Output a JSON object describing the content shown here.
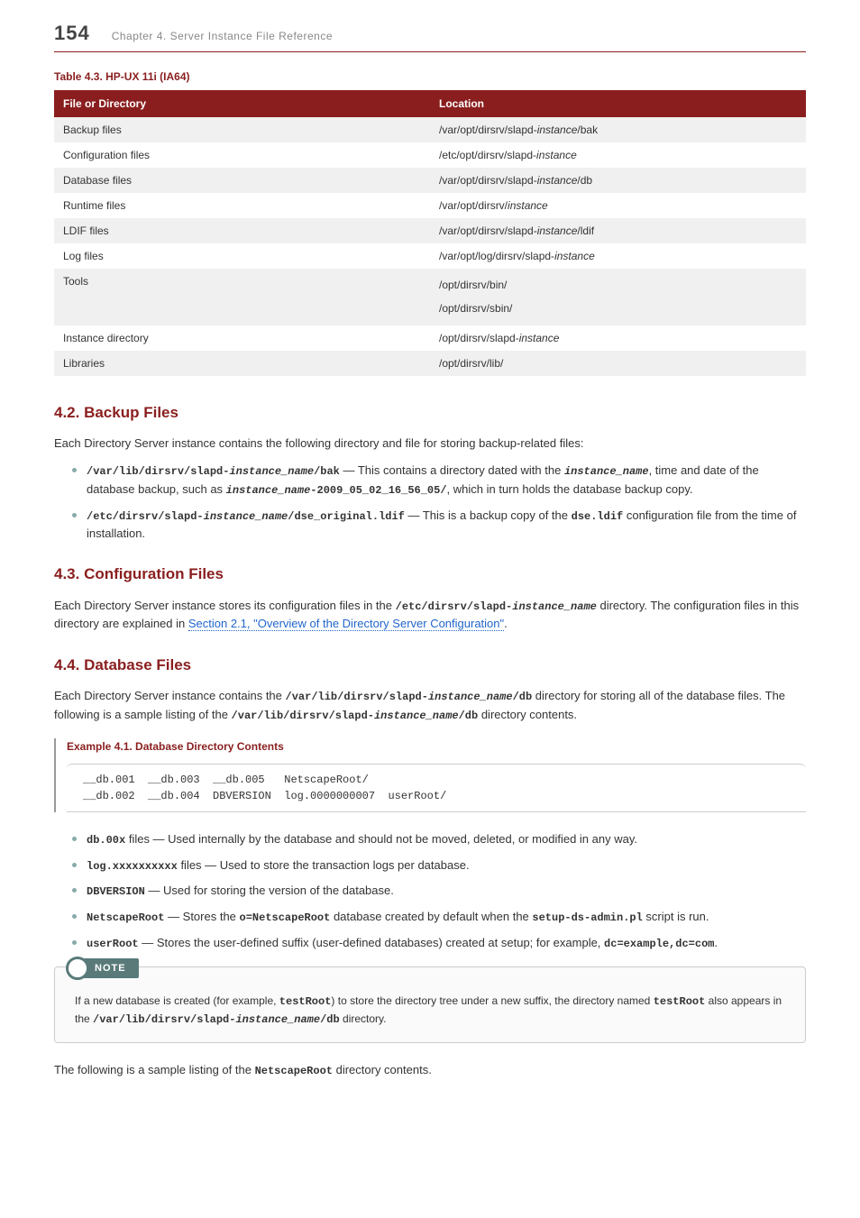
{
  "header": {
    "page_number": "154",
    "chapter": "Chapter 4. Server Instance File Reference"
  },
  "table": {
    "caption": "Table 4.3. HP-UX 11i (IA64)",
    "col1": "File or Directory",
    "col2": "Location",
    "rows": [
      {
        "name": "Backup files",
        "pre": "/var/opt/dirsrv/slapd-",
        "it": "instance",
        "post": "/bak"
      },
      {
        "name": "Configuration files",
        "pre": "/etc/opt/dirsrv/slapd-",
        "it": "instance",
        "post": ""
      },
      {
        "name": "Database files",
        "pre": "/var/opt/dirsrv/slapd-",
        "it": "instance",
        "post": "/db"
      },
      {
        "name": "Runtime files",
        "pre": "/var/opt/dirsrv/",
        "it": "instance",
        "post": ""
      },
      {
        "name": "LDIF files",
        "pre": "/var/opt/dirsrv/slapd-",
        "it": "instance",
        "post": "/ldif"
      },
      {
        "name": "Log files",
        "pre": "/var/opt/log/dirsrv/slapd-",
        "it": "instance",
        "post": ""
      }
    ],
    "tools_name": "Tools",
    "tools_loc1": "/opt/dirsrv/bin/",
    "tools_loc2": "/opt/dirsrv/sbin/",
    "instdir": {
      "name": "Instance directory",
      "pre": "/opt/dirsrv/slapd-",
      "it": "instance",
      "post": ""
    },
    "libraries": {
      "name": "Libraries",
      "loc": "/opt/dirsrv/lib/"
    }
  },
  "s42": {
    "heading": "4.2. Backup Files",
    "intro": "Each Directory Server instance contains the following directory and file for storing backup-related files:",
    "b1_code": "/var/lib/dirsrv/slapd-",
    "b1_it": "instance_name",
    "b1_code2": "/bak",
    "b1_t1": " — This contains a directory dated with the ",
    "b1_it2": "instance_name",
    "b1_t2": ", time and date of the database backup, such as ",
    "b1_it3": "instance_name",
    "b1_code3": "-2009_05_02_16_56_05/",
    "b1_t3": ", which in turn holds the database backup copy.",
    "b2_code": "/etc/dirsrv/slapd-",
    "b2_it": "instance_name",
    "b2_code2": "/dse_original.ldif",
    "b2_t1": " — This is a backup copy of the ",
    "b2_dse": "dse.ldif",
    "b2_t2": " configuration file from the time of installation."
  },
  "s43": {
    "heading": "4.3. Configuration Files",
    "p1a": "Each Directory Server instance stores its configuration files in the ",
    "p1_code": "/etc/dirsrv/slapd-",
    "p1_it": "instance_name",
    "p1b": " directory. The configuration files in this directory are explained in ",
    "link": "Section 2.1, \"Overview of the Directory Server Configuration\"",
    "p1c": "."
  },
  "s44": {
    "heading": "4.4. Database Files",
    "p1a": "Each Directory Server instance contains the ",
    "p1_code1": "/var/lib/dirsrv/slapd-",
    "p1_it1": "instance_name",
    "p1_code1b": "/db",
    "p1b": " directory for storing all of the database files. The following is a sample listing of the ",
    "p1_code2": "/var/lib/dirsrv/slapd-",
    "p1_it2": "instance_name",
    "p1_code2b": "/db",
    "p1c": " directory contents.",
    "example_title": "Example 4.1. Database Directory Contents",
    "example_code": "__db.001  __db.003  __db.005   NetscapeRoot/\n__db.002  __db.004  DBVERSION  log.0000000007  userRoot/",
    "li1_code": "db.00x",
    "li1_t": " files — Used internally by the database and should not be moved, deleted, or modified in any way.",
    "li2_code": "log.xxxxxxxxxx",
    "li2_t": " files — Used to store the transaction logs per database.",
    "li3_code": "DBVERSION",
    "li3_t": " — Used for storing the version of the database.",
    "li4_code": "NetscapeRoot",
    "li4_t1": " — Stores the ",
    "li4_code2": "o=NetscapeRoot",
    "li4_t2": " database created by default when the ",
    "li4_code3": "setup-ds-admin.pl",
    "li4_t3": " script is run.",
    "li5_code": "userRoot",
    "li5_t1": " — Stores the user-defined suffix (user-defined databases) created at setup; for example, ",
    "li5_code2": "dc=example,dc=com",
    "li5_t2": ".",
    "note_label": "NOTE",
    "note_t1": "If a new database is created (for example, ",
    "note_c1": "testRoot",
    "note_t2": ") to store the directory tree under a new suffix, the directory named ",
    "note_c2": "testRoot",
    "note_t3": " also appears in the ",
    "note_c3": "/var/lib/dirsrv/slapd-",
    "note_it": "instance_name",
    "note_c3b": "/db",
    "note_t4": " directory.",
    "closing_a": "The following is a sample listing of the ",
    "closing_code": "NetscapeRoot",
    "closing_b": " directory contents."
  }
}
